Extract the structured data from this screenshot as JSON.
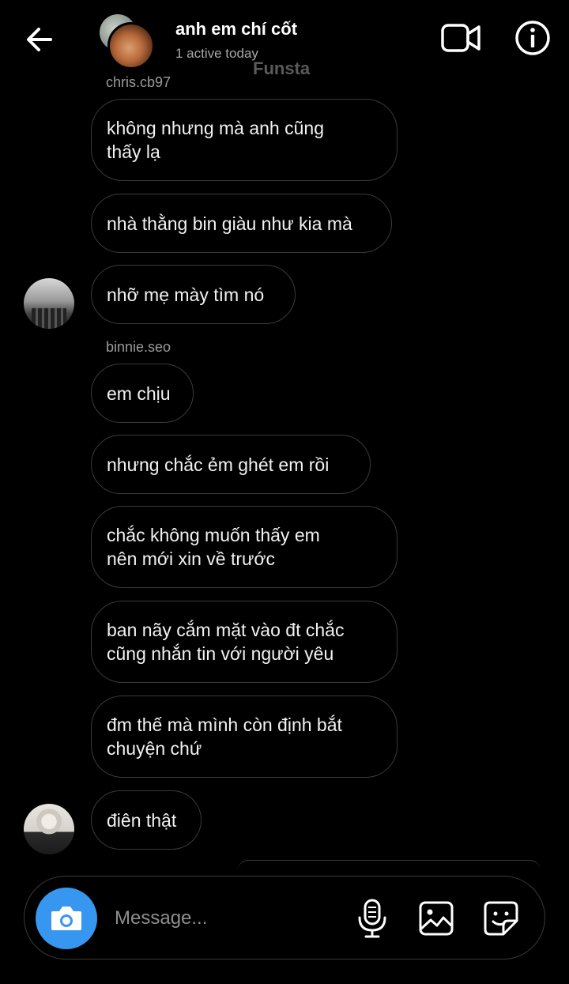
{
  "header": {
    "title": "anh em chí cốt",
    "subtitle": "1 active today",
    "watermark": "Funsta"
  },
  "messages": [
    {
      "sender": "chris.cb97"
    },
    {
      "text": "không nhưng mà anh cũng\nthấy lạ"
    },
    {
      "text": "nhà thằng bin giàu như kia mà"
    },
    {
      "text": "nhỡ mẹ mày tìm nó"
    },
    {
      "sender": "binnie.seo"
    },
    {
      "text": "em chịu"
    },
    {
      "text": "nhưng chắc ẻm ghét em rồi"
    },
    {
      "text": "chắc không muốn thấy em\nnên mới xin về trước"
    },
    {
      "text": "ban nãy cắm mặt vào đt chắc\ncũng nhắn tin với người yêu"
    },
    {
      "text": "đm thế mà mình còn định bắt\nchuyện chứ"
    },
    {
      "text": "điên thật"
    }
  ],
  "composer": {
    "placeholder": "Message..."
  },
  "icons": {
    "back": "back-arrow-icon",
    "video": "video-camera-icon",
    "info": "info-icon",
    "camera": "camera-icon",
    "mic": "microphone-icon",
    "gallery": "gallery-icon",
    "sticker": "sticker-icon"
  },
  "colors": {
    "background": "#000000",
    "accent": "#3797f0",
    "bubble_border": "#3a3a3a",
    "secondary_text": "#a8a8a8"
  }
}
